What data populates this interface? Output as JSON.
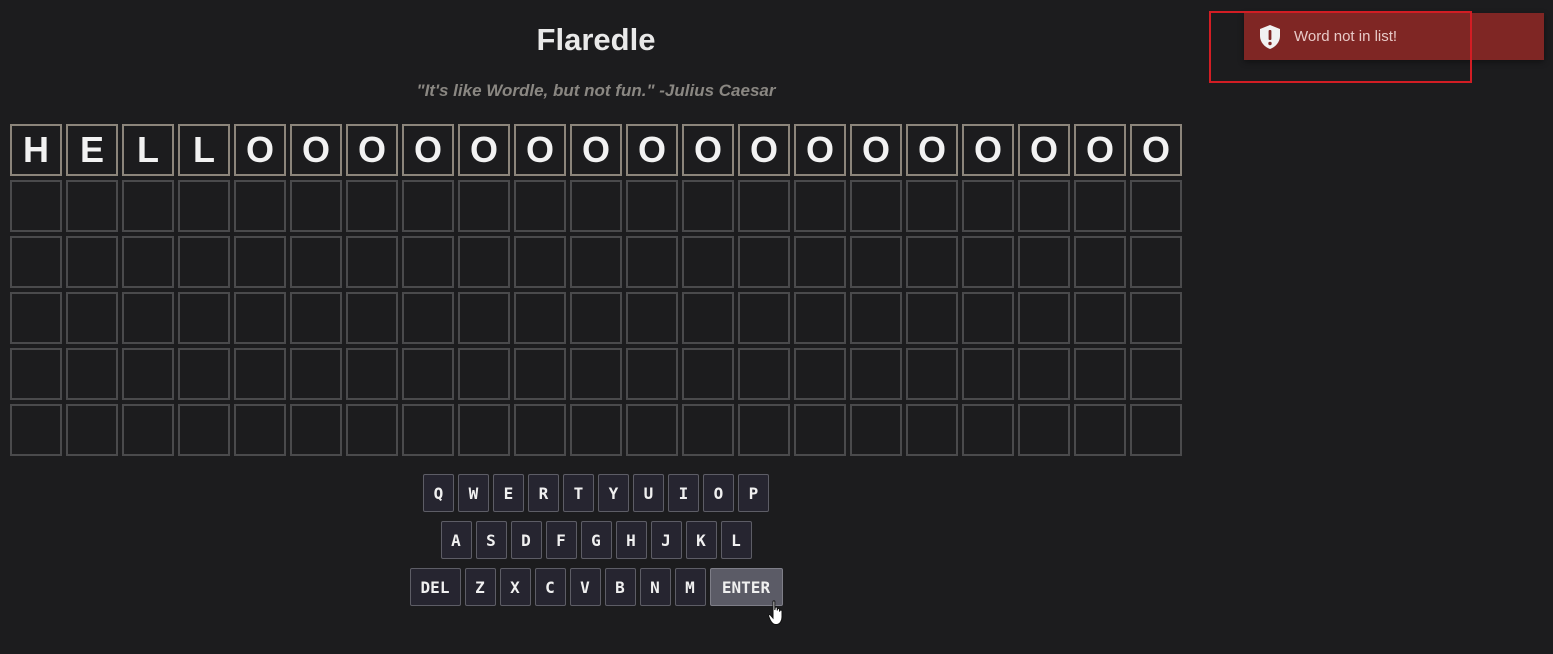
{
  "app": {
    "title": "Flaredle",
    "subtitle": "\"It's like Wordle, but not fun.\" -Julius Caesar"
  },
  "board": {
    "rows": [
      [
        "H",
        "E",
        "L",
        "L",
        "O",
        "O",
        "O",
        "O",
        "O",
        "O",
        "O",
        "O",
        "O",
        "O",
        "O",
        "O",
        "O",
        "O",
        "O",
        "O",
        "O"
      ],
      [
        "",
        "",
        "",
        "",
        "",
        "",
        "",
        "",
        "",
        "",
        "",
        "",
        "",
        "",
        "",
        "",
        "",
        "",
        "",
        "",
        ""
      ],
      [
        "",
        "",
        "",
        "",
        "",
        "",
        "",
        "",
        "",
        "",
        "",
        "",
        "",
        "",
        "",
        "",
        "",
        "",
        "",
        "",
        ""
      ],
      [
        "",
        "",
        "",
        "",
        "",
        "",
        "",
        "",
        "",
        "",
        "",
        "",
        "",
        "",
        "",
        "",
        "",
        "",
        "",
        "",
        ""
      ],
      [
        "",
        "",
        "",
        "",
        "",
        "",
        "",
        "",
        "",
        "",
        "",
        "",
        "",
        "",
        "",
        "",
        "",
        "",
        "",
        "",
        ""
      ],
      [
        "",
        "",
        "",
        "",
        "",
        "",
        "",
        "",
        "",
        "",
        "",
        "",
        "",
        "",
        "",
        "",
        "",
        "",
        "",
        "",
        ""
      ]
    ]
  },
  "keyboard": {
    "rows": [
      [
        "Q",
        "W",
        "E",
        "R",
        "T",
        "Y",
        "U",
        "I",
        "O",
        "P"
      ],
      [
        "A",
        "S",
        "D",
        "F",
        "G",
        "H",
        "J",
        "K",
        "L"
      ],
      [
        "DEL",
        "Z",
        "X",
        "C",
        "V",
        "B",
        "N",
        "M",
        "ENTER"
      ]
    ]
  },
  "toast": {
    "message": "Word not in list!",
    "icon": "shield-exclamation-icon",
    "background": "#7f2624"
  },
  "colors": {
    "background": "#1c1c1e",
    "tile_border_empty": "#4a4a4c",
    "tile_border_filled": "#8c857b",
    "key_background": "#262530",
    "enter_background": "#5b5b66",
    "highlight_outline": "#d21d24"
  }
}
